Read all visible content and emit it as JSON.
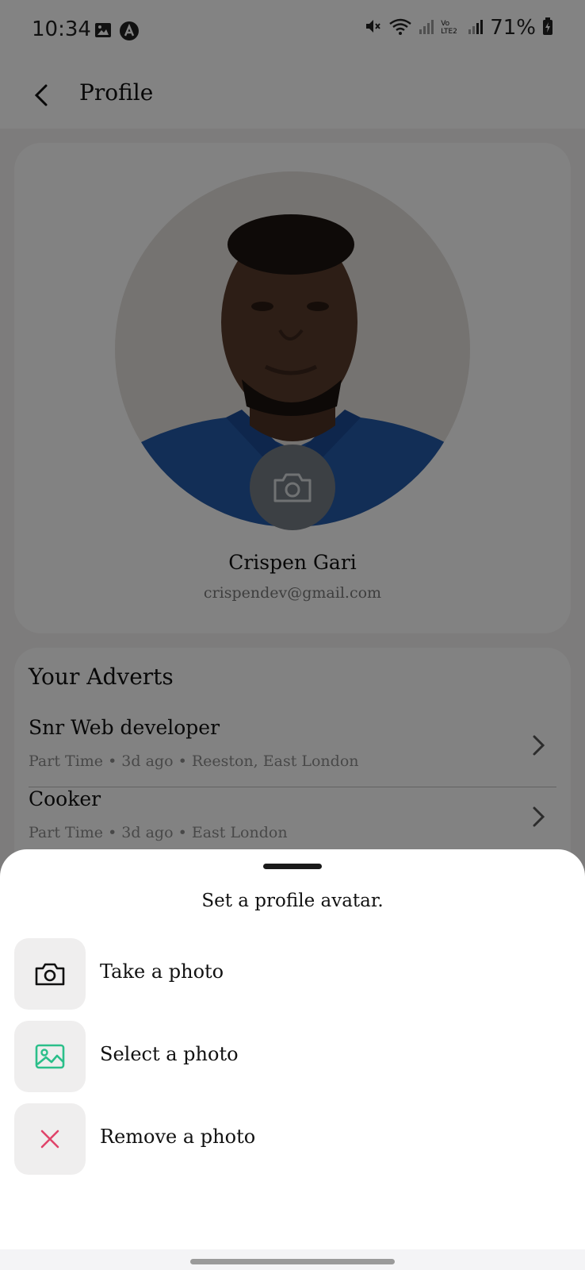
{
  "status_bar": {
    "time": "10:34",
    "battery": "71%",
    "network_label": "Vo LTE2",
    "icons": [
      "image-icon",
      "app-a-icon",
      "mute-icon",
      "wifi-icon",
      "signal-icon",
      "battery-icon"
    ]
  },
  "header": {
    "title": "Profile"
  },
  "profile": {
    "name": "Crispen Gari",
    "email": "crispendev@gmail.com"
  },
  "adverts": {
    "title": "Your Adverts",
    "items": [
      {
        "title": "Snr Web developer",
        "meta": "Part Time • 3d ago • Reeston, East London"
      },
      {
        "title": "Cooker",
        "meta": "Part Time • 3d ago • East London"
      }
    ]
  },
  "sheet": {
    "title": "Set a profile avatar.",
    "options": [
      {
        "label": "Take a photo",
        "icon": "camera-icon",
        "color": "#111111"
      },
      {
        "label": "Select a photo",
        "icon": "image-icon",
        "color": "#2bbf8a"
      },
      {
        "label": "Remove a photo",
        "icon": "close-icon",
        "color": "#e0446a"
      }
    ]
  },
  "colors": {
    "overlay": "rgba(0,0,0,0.48)",
    "card_bg": "#fafafa",
    "page_bg": "#f0eeee",
    "select_icon": "#2bbf8a",
    "remove_icon": "#e0446a"
  }
}
